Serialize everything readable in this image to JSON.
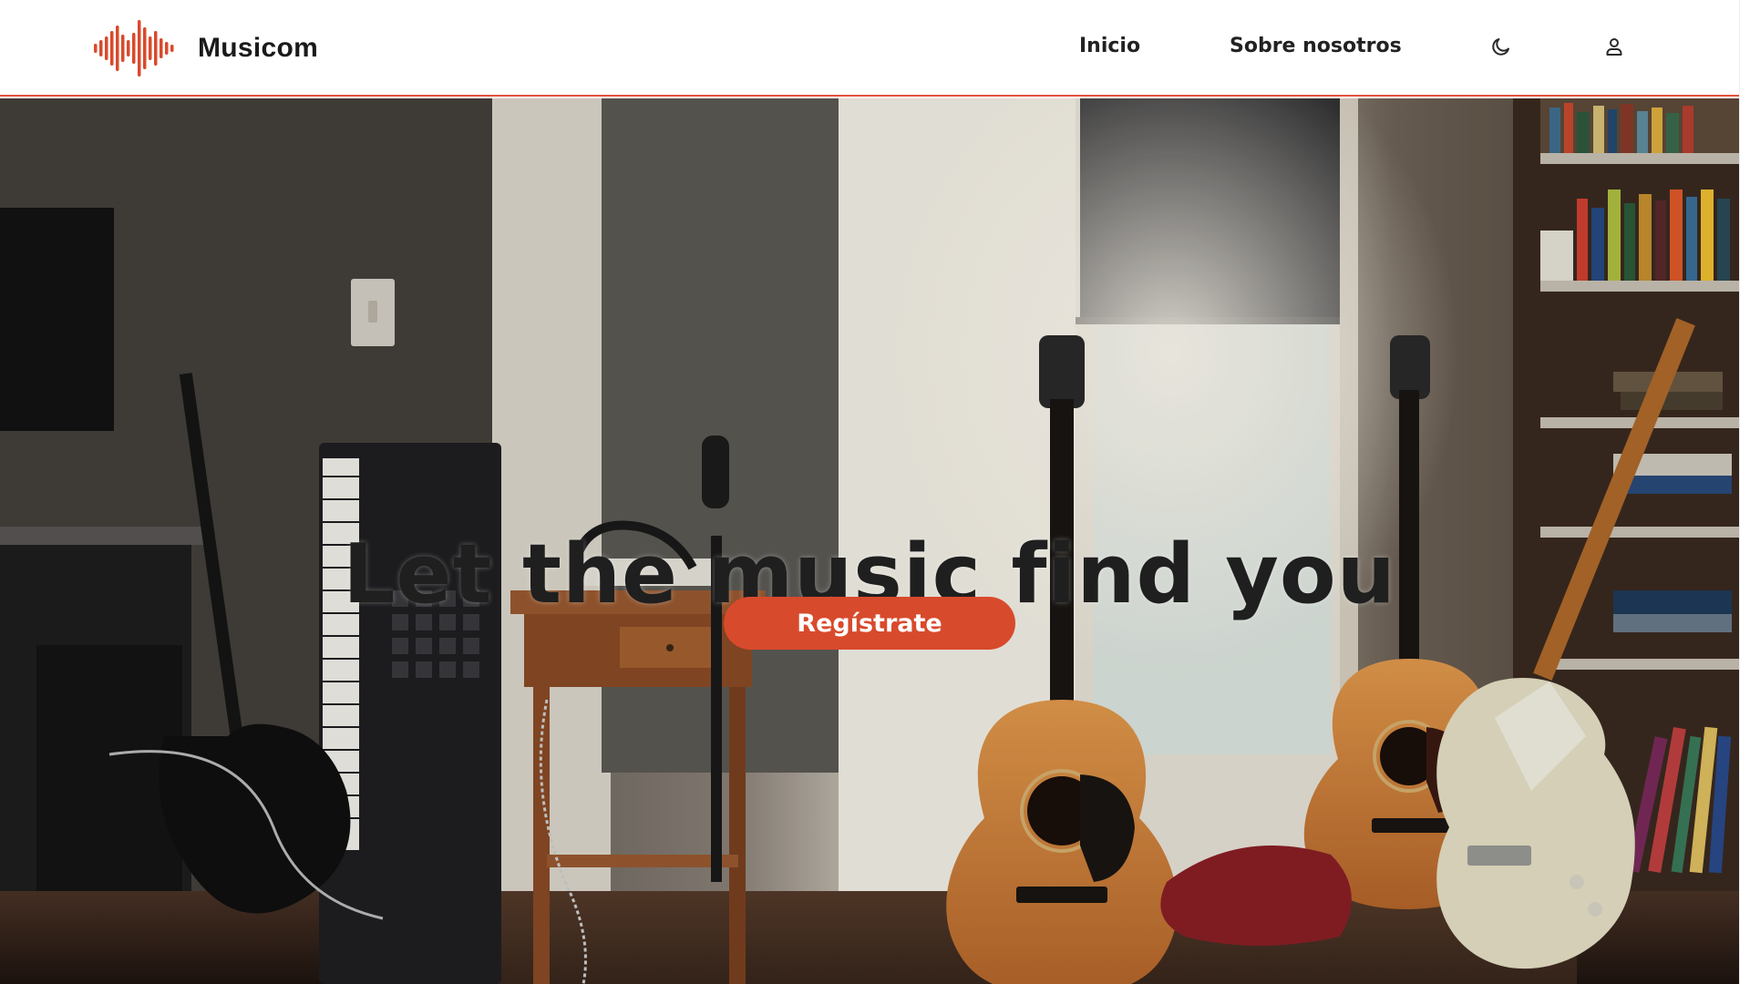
{
  "brand": {
    "name": "Musicom",
    "logo_icon": "soundwave-icon",
    "accent_color": "#d84a2c"
  },
  "nav": {
    "links": [
      {
        "label": "Inicio"
      },
      {
        "label": "Sobre nosotros"
      }
    ],
    "theme_icon": "moon-icon",
    "user_icon": "user-icon"
  },
  "hero": {
    "title": "Let the music find you",
    "cta_label": "Regístrate",
    "background": "music-room-photo"
  }
}
